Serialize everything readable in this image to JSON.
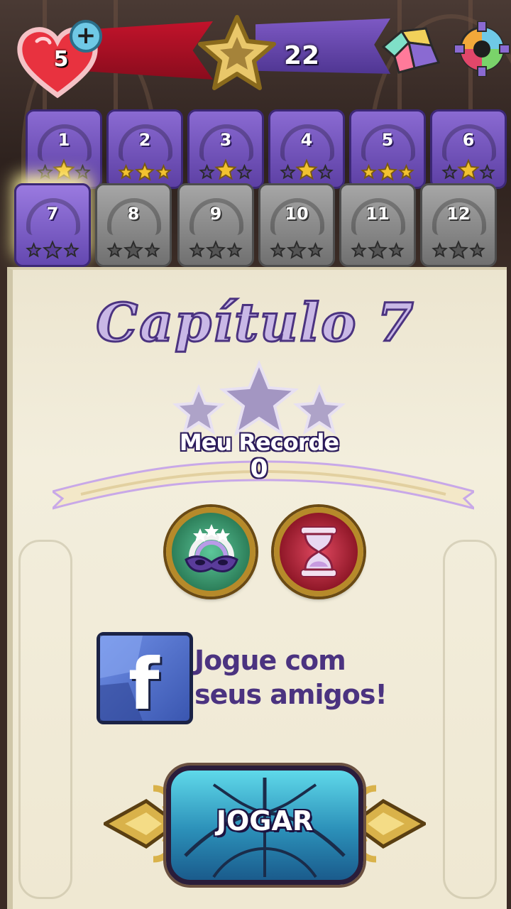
{
  "hud": {
    "lives": "5",
    "plus": "+",
    "stars_total": "22"
  },
  "levels": [
    {
      "num": "1",
      "stars": 1,
      "state": "unlocked"
    },
    {
      "num": "2",
      "stars": 3,
      "state": "unlocked"
    },
    {
      "num": "3",
      "stars": 1,
      "state": "unlocked"
    },
    {
      "num": "4",
      "stars": 1,
      "state": "unlocked"
    },
    {
      "num": "5",
      "stars": 3,
      "state": "unlocked"
    },
    {
      "num": "6",
      "stars": 1,
      "state": "unlocked"
    },
    {
      "num": "7",
      "stars": 0,
      "state": "current"
    },
    {
      "num": "8",
      "stars": 0,
      "state": "locked"
    },
    {
      "num": "9",
      "stars": 0,
      "state": "locked"
    },
    {
      "num": "10",
      "stars": 0,
      "state": "locked"
    },
    {
      "num": "11",
      "stars": 0,
      "state": "locked"
    },
    {
      "num": "12",
      "stars": 0,
      "state": "locked"
    }
  ],
  "chapter": {
    "title": "Capítulo 7",
    "stars_earned": 0,
    "record_label": "Meu Recorde",
    "record_value": "0"
  },
  "boosters": [
    {
      "icon": "mask-booster-icon"
    },
    {
      "icon": "hourglass-booster-icon"
    }
  ],
  "facebook": {
    "letter": "f",
    "line1": "Jogue com",
    "line2": "seus amigos!"
  },
  "play": {
    "label": "JOGAR"
  },
  "colors": {
    "purple": "#5d40a4",
    "gold": "#f2c230",
    "locked_gray": "#8a8a8a",
    "parchment": "#f0ead6"
  }
}
